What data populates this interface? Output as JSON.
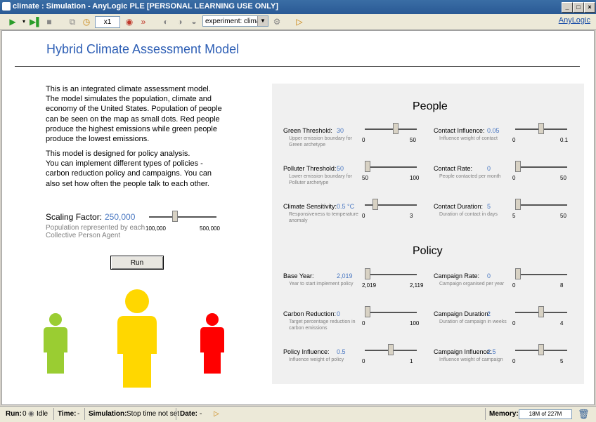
{
  "window": {
    "title": "climate : Simulation - AnyLogic PLE [PERSONAL LEARNING USE ONLY]",
    "min": "_",
    "max": "□",
    "close": "×"
  },
  "toolbar": {
    "speed": "x1",
    "experiment": "experiment: climat...",
    "brand": "AnyLogic"
  },
  "page": {
    "title": "Hybrid Climate Assessment Model",
    "intro": "This is an integrated climate assessment model.\nThe model simulates the population, climate and\neconomy of the United States. Population of people\ncan be seen on the map as small dots. Red people\nproduce the highest emissions while green people\nproduce the lowest emissions.",
    "policy_text": "This model is designed for policy analysis.\nYou can implement different types of policies -\ncarbon reduction policy and campaigns. You can\nalso set how often the people talk to each other.",
    "run_label": "Run"
  },
  "scaling": {
    "label": "Scaling Factor:",
    "value": "250,000",
    "desc": "Population represented by each Collective Person Agent",
    "min": "100,000",
    "max": "500,000",
    "level": 0.375
  },
  "people": {
    "title": "People",
    "params": [
      {
        "label": "Green Threshold:",
        "value": "30",
        "desc": "Upper emission boundary for Green archetype",
        "min": "0",
        "max": "50",
        "level": 0.6
      },
      {
        "label": "Contact Influence:",
        "value": "0.05",
        "desc": "Influence weight of contact",
        "min": "0",
        "max": "0.1",
        "level": 0.5
      },
      {
        "label": "Polluter Threshold:",
        "value": "50",
        "desc": "Lower emission boundary for Polluter archetype",
        "min": "50",
        "max": "100",
        "level": 0
      },
      {
        "label": "Contact Rate:",
        "value": "0",
        "desc": "People contacted per month",
        "min": "0",
        "max": "50",
        "level": 0
      },
      {
        "label": "Climate Sensitivity:",
        "value": "0.5 °C",
        "desc": "Responsiveness to temperature anomaly",
        "min": "0",
        "max": "3",
        "level": 0.17
      },
      {
        "label": "Contact Duration:",
        "value": "5",
        "desc": "Duration of contact in days",
        "min": "5",
        "max": "50",
        "level": 0
      }
    ]
  },
  "policy": {
    "title": "Policy",
    "params": [
      {
        "label": "Base Year:",
        "value": "2,019",
        "desc": "Year to start implement policy",
        "min": "2,019",
        "max": "2,119",
        "level": 0
      },
      {
        "label": "Campaign Rate:",
        "value": "0",
        "desc": "Campaign organised per year",
        "min": "0",
        "max": "8",
        "level": 0
      },
      {
        "label": "Carbon Reduction:",
        "value": "0",
        "desc": "Target percentage reduction in carbon emissions",
        "min": "0",
        "max": "100",
        "level": 0
      },
      {
        "label": "Campaign Duration:",
        "value": "2",
        "desc": "Duration of campaign in weeks",
        "min": "0",
        "max": "4",
        "level": 0.5
      },
      {
        "label": "Policy Influence:",
        "value": "0.5",
        "desc": "Influence weight of policy",
        "min": "0",
        "max": "1",
        "level": 0.5
      },
      {
        "label": "Campaign Influence:",
        "value": "2.5",
        "desc": "Influence weight of campaign",
        "min": "0",
        "max": "5",
        "level": 0.5
      }
    ]
  },
  "colors": {
    "green": "#9acd32",
    "yellow": "#ffd700",
    "red": "#ff0000",
    "accent": "#2e5fb5"
  },
  "status": {
    "run_label": "Run:",
    "run_value": "0",
    "state": "Idle",
    "time_label": "Time:",
    "time_value": "-",
    "sim_label": "Simulation:",
    "sim_value": "Stop time not set",
    "date_label": "Date:",
    "date_value": "-",
    "memory_label": "Memory:",
    "memory_value": "18M of 227M"
  }
}
